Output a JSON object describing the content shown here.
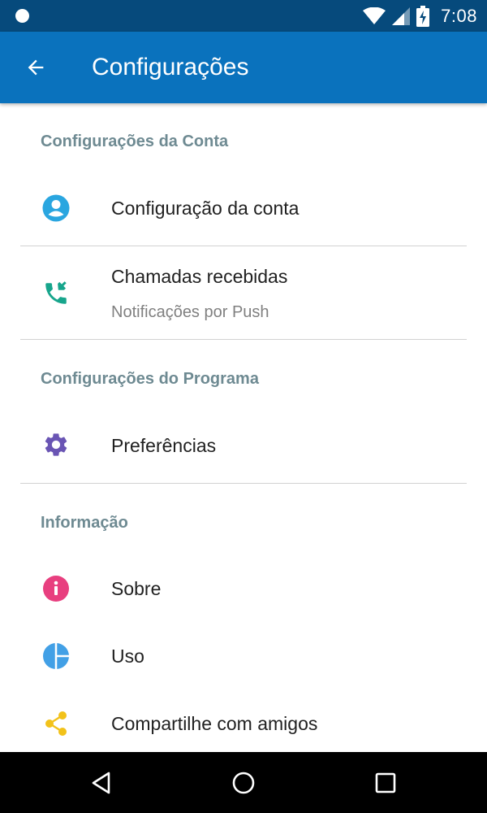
{
  "status_bar": {
    "time": "7:08",
    "background": "#064a7c"
  },
  "app_bar": {
    "title": "Configurações",
    "background": "#0a72bd",
    "back_icon": "arrow-back-icon"
  },
  "sections": [
    {
      "header": "Configurações da Conta",
      "items": [
        {
          "title": "Configuração da conta",
          "subtitle": "",
          "icon": "account-circle-icon",
          "icon_color": "#2aa6e0"
        },
        {
          "title": "Chamadas recebidas",
          "subtitle": "Notificações por Push",
          "icon": "incoming-call-icon",
          "icon_color": "#17a58c"
        }
      ]
    },
    {
      "header": "Configurações do Programa",
      "items": [
        {
          "title": "Preferências",
          "subtitle": "",
          "icon": "gear-icon",
          "icon_color": "#6a55b4"
        }
      ]
    },
    {
      "header": "Informação",
      "items": [
        {
          "title": "Sobre",
          "subtitle": "",
          "icon": "info-icon",
          "icon_color": "#e83f7f"
        },
        {
          "title": "Uso",
          "subtitle": "",
          "icon": "pie-chart-icon",
          "icon_color": "#42a0e6"
        },
        {
          "title": "Compartilhe com amigos",
          "subtitle": "",
          "icon": "share-icon",
          "icon_color": "#f2c21a"
        }
      ]
    }
  ],
  "header_color": "#6e8a92",
  "nav_bar": {
    "back": "nav-back-icon",
    "home": "nav-home-icon",
    "recents": "nav-recents-icon"
  }
}
